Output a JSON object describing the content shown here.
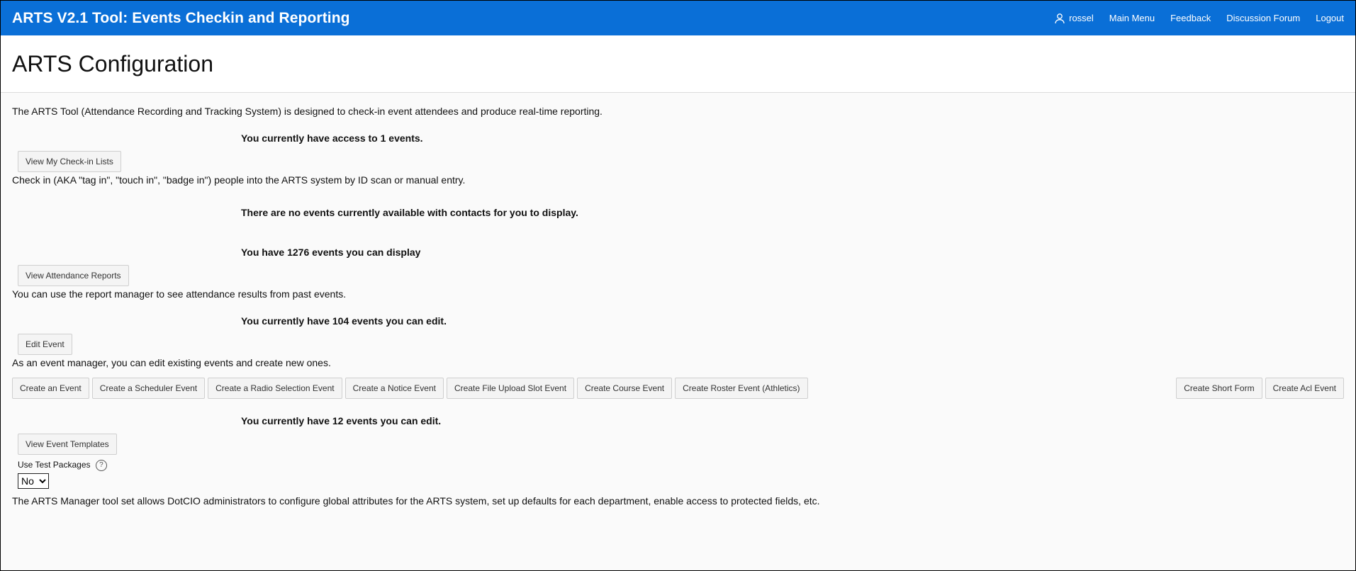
{
  "header": {
    "app_title": "ARTS V2.1 Tool: Events Checkin and Reporting",
    "user": "rossel",
    "nav": [
      "Main Menu",
      "Feedback",
      "Discussion Forum",
      "Logout"
    ],
    "icon": "user-icon"
  },
  "page": {
    "title": "ARTS Configuration"
  },
  "intro": "The ARTS Tool (Attendance Recording and Tracking System) is designed to check-in event attendees and produce real-time reporting.",
  "checkin": {
    "access_note": "You currently have access to 1 events.",
    "button": "View My Check-in Lists",
    "description": "Check in (AKA \"tag in\", \"touch in\", \"badge in\") people into the ARTS system by ID scan or manual entry."
  },
  "no_events_note": "There are no events currently available with contacts for you to display.",
  "reports": {
    "note": "You have 1276 events you can display",
    "button": "View Attendance Reports",
    "description": "You can use the report manager to see attendance results from past events."
  },
  "edit": {
    "note": "You currently have 104 events you can edit.",
    "button": "Edit Event",
    "description": "As an event manager, you can edit existing events and create new ones."
  },
  "create_buttons": [
    "Create an Event",
    "Create a Scheduler Event",
    "Create a Radio Selection Event",
    "Create a Notice Event",
    "Create File Upload Slot Event",
    "Create Course Event",
    "Create Roster Event (Athletics)"
  ],
  "right_buttons": [
    "Create Short Form",
    "Create Acl Event"
  ],
  "templates": {
    "note": "You currently have 12 events you can edit.",
    "button": "View Event Templates"
  },
  "test_packages": {
    "label": "Use Test Packages",
    "help": "?",
    "selected": "No",
    "help_icon": "question-circle-icon"
  },
  "footer_text": "The ARTS Manager tool set allows DotCIO administrators to configure global attributes for the ARTS system, set up defaults for each department, enable access to protected fields, etc."
}
